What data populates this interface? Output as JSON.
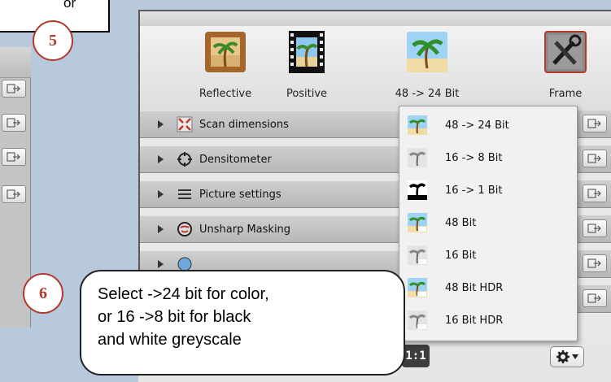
{
  "left_fragment": {
    "cut_text": "or"
  },
  "badges": {
    "step5": "5",
    "step6": "6"
  },
  "toolbar": {
    "reflective_label": "Reflective",
    "positive_label": "Positive",
    "bit_label": "48 -> 24 Bit",
    "frame_label": "Frame"
  },
  "rows": [
    {
      "label": "Scan dimensions",
      "icon": "scan-dimensions-icon"
    },
    {
      "label": "Densitometer",
      "icon": "crosshair-icon"
    },
    {
      "label": "Picture settings",
      "icon": "sliders-icon"
    },
    {
      "label": "Unsharp Masking",
      "icon": "unsharp-mask-icon"
    },
    {
      "label": "",
      "icon": "globe-icon"
    }
  ],
  "menu": {
    "items": [
      {
        "label": "48 -> 24 Bit",
        "icon": "palm-color-icon"
      },
      {
        "label": "16 -> 8 Bit",
        "icon": "palm-grey-icon"
      },
      {
        "label": "16 -> 1 Bit",
        "icon": "palm-black-icon"
      },
      {
        "label": "48 Bit",
        "icon": "palm-color-48-icon"
      },
      {
        "label": "16 Bit",
        "icon": "palm-grey-16-icon"
      },
      {
        "label": "48 Bit HDR",
        "icon": "palm-color-hdr-icon"
      },
      {
        "label": "16 Bit HDR",
        "icon": "palm-grey-hdr-icon"
      }
    ]
  },
  "bottom": {
    "ratio_label": "1:1"
  },
  "callout": {
    "line1": "Select ->24 bit for color,",
    "line2": "or 16 ->8 bit for black",
    "line3": "and white greyscale"
  },
  "colors": {
    "badge_red": "#b03a2e",
    "background": "#b8c9dd"
  }
}
